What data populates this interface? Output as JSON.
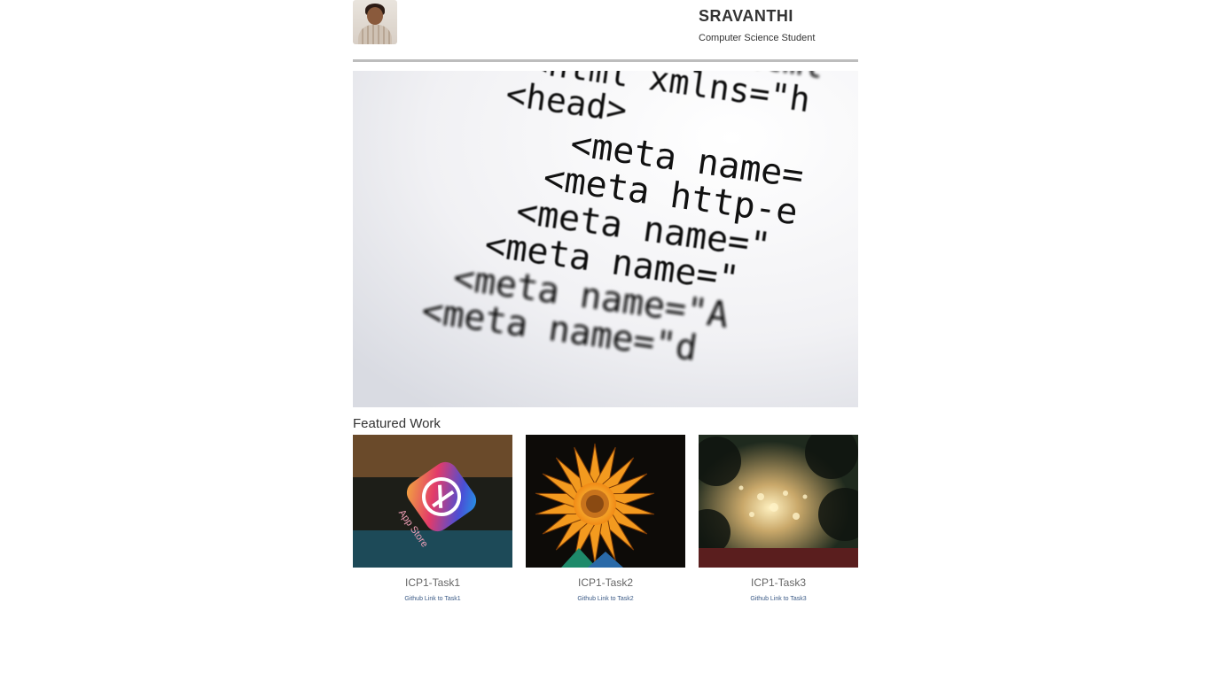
{
  "header": {
    "name": "SRAVANTHI",
    "role": "Computer Science Student"
  },
  "hero": {
    "code_lines": [
      "<!DOCTYPE html",
      "<html xmlns=\"h",
      "<head>",
      "<meta name=",
      "<meta http-e",
      "<meta name=\"",
      "<meta name=\"",
      "<meta name=\"A",
      "<meta name=\"d"
    ]
  },
  "featured": {
    "title": "Featured Work",
    "items": [
      {
        "title": "ICP1-Task1",
        "link": "Github Link to Task1",
        "thumb_text": "App Store"
      },
      {
        "title": "ICP1-Task2",
        "link": "Github Link to Task2"
      },
      {
        "title": "ICP1-Task3",
        "link": "Github Link to Task3"
      }
    ]
  }
}
